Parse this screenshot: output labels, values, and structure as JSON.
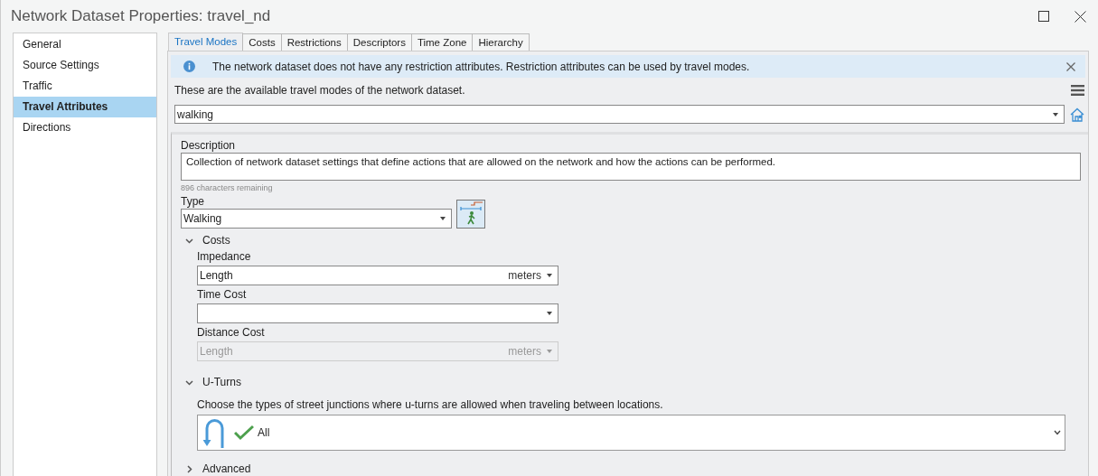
{
  "window": {
    "title": "Network Dataset Properties: travel_nd"
  },
  "sidebar": {
    "items": [
      {
        "label": "General",
        "selected": false
      },
      {
        "label": "Source Settings",
        "selected": false
      },
      {
        "label": "Traffic",
        "selected": false
      },
      {
        "label": "Travel Attributes",
        "selected": true
      },
      {
        "label": "Directions",
        "selected": false
      }
    ]
  },
  "tabs": [
    {
      "label": "Travel Modes",
      "selected": true
    },
    {
      "label": "Costs",
      "selected": false
    },
    {
      "label": "Restrictions",
      "selected": false
    },
    {
      "label": "Descriptors",
      "selected": false
    },
    {
      "label": "Time Zone",
      "selected": false
    },
    {
      "label": "Hierarchy",
      "selected": false
    }
  ],
  "info_banner": {
    "message": "The network dataset does not have any restriction attributes. Restriction attributes can be used by travel modes."
  },
  "travel_modes": {
    "caption": "These are the available travel modes of the network dataset.",
    "selected_mode": "walking"
  },
  "description": {
    "label": "Description",
    "value": "Collection of network dataset settings that define actions that are allowed on the network and how the actions can be performed.",
    "remaining": "896 characters remaining"
  },
  "type": {
    "label": "Type",
    "value": "Walking"
  },
  "sections": [
    {
      "kind": "costs",
      "title": "Costs",
      "expanded": true,
      "fields": [
        {
          "label": "Impedance",
          "value": "Length",
          "unit": "meters",
          "disabled": false
        },
        {
          "label": "Time Cost",
          "disabled": false
        },
        {
          "label": "Distance Cost",
          "value": "Length",
          "unit": "meters",
          "disabled": true
        }
      ]
    },
    {
      "kind": "uturns",
      "title": "U-Turns",
      "expanded": true,
      "caption": "Choose the types of street junctions where u-turns are allowed when traveling between locations.",
      "value": "All"
    },
    {
      "title": "Advanced",
      "expanded": false
    }
  ]
}
